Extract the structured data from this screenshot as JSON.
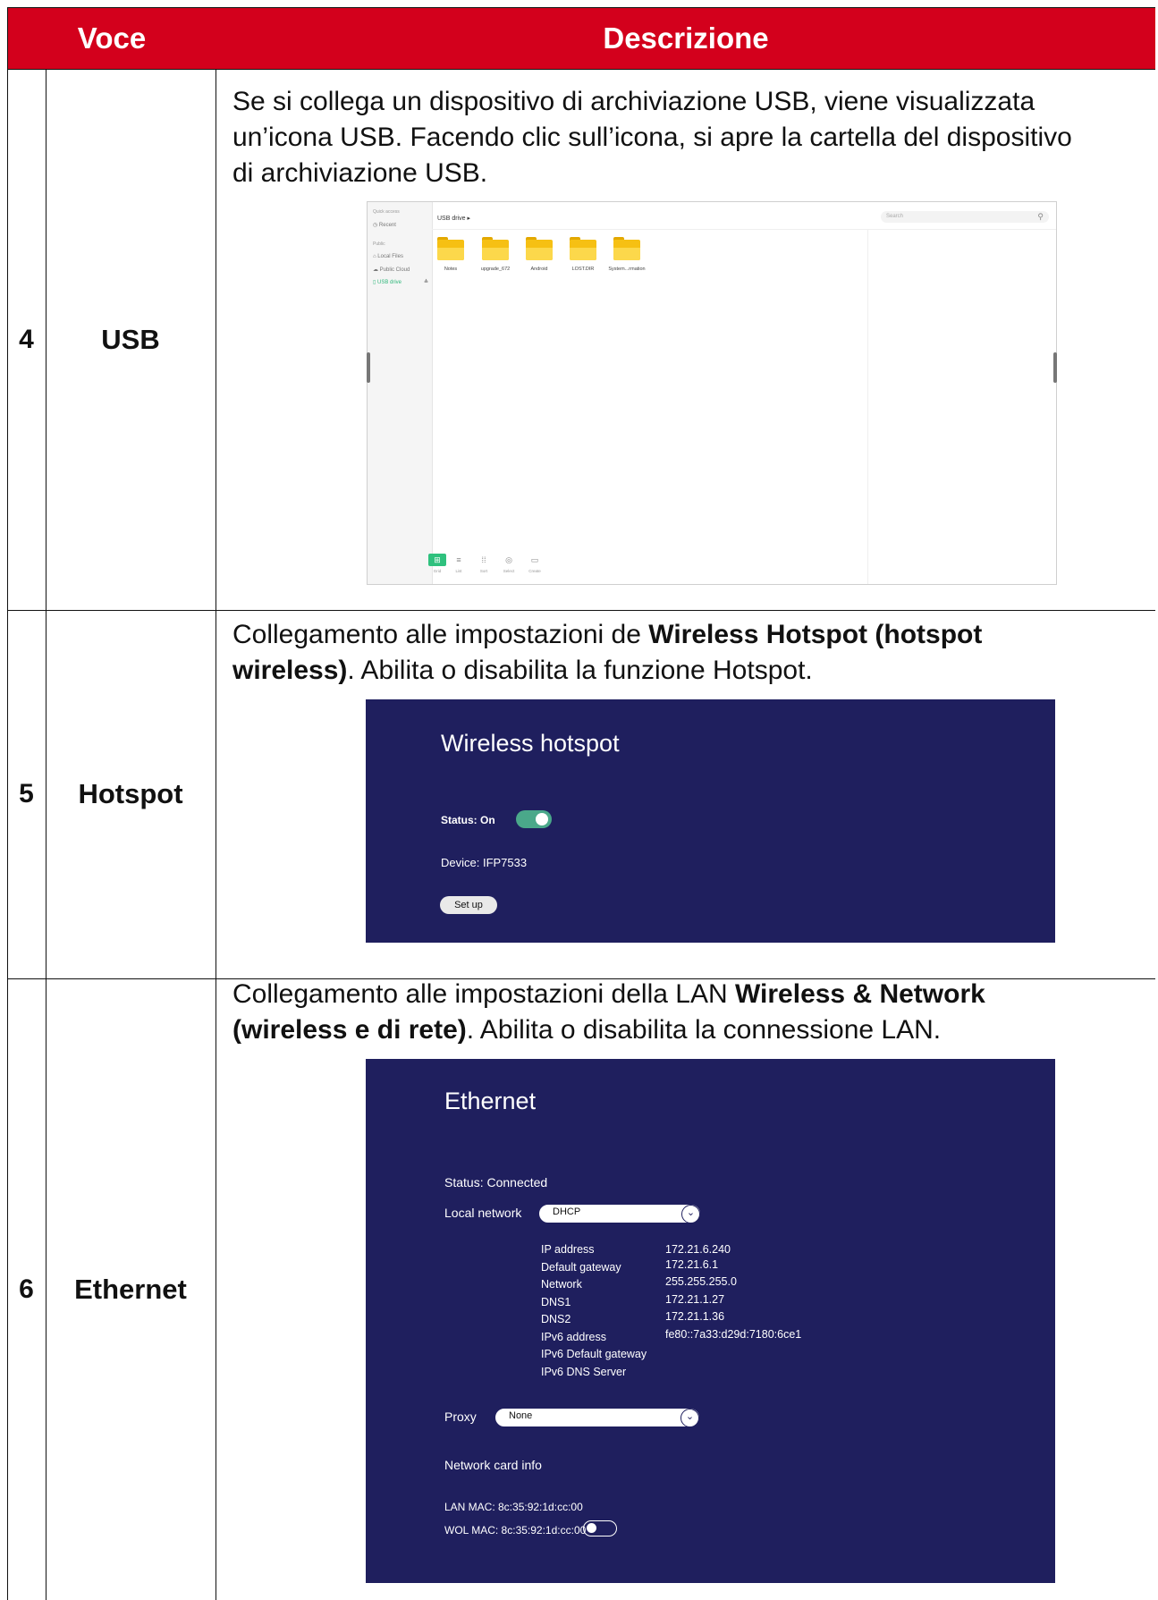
{
  "header": {
    "col_item": "Voce",
    "col_desc": "Descrizione"
  },
  "rows": [
    {
      "number": "4",
      "item": "USB",
      "desc_line1": "Se si collega un dispositivo di archiviazione USB, viene visualizzata",
      "desc_line2": "un’icona USB. Facendo clic sull’icona, si apre la cartella del dispositivo",
      "desc_line3": "di archiviazione USB."
    },
    {
      "number": "5",
      "item": "Hotspot",
      "desc_pre": "Collegamento alle impostazioni de ",
      "desc_bold1": "Wireless Hotspot (hotspot",
      "desc_bold2": "wireless)",
      "desc_post": ". Abilita o disabilita la funzione Hotspot."
    },
    {
      "number": "6",
      "item": "Ethernet",
      "desc_pre": "Collegamento alle impostazioni della LAN ",
      "desc_bold1": "Wireless & Network",
      "desc_bold2": "(wireless e di rete)",
      "desc_post": ". Abilita o disabilita la connessione LAN."
    }
  ],
  "usb_screen": {
    "sidebar": {
      "quick_access": "Quick access",
      "recent": "Recent",
      "public": "Public",
      "local_files": "Local Files",
      "public_cloud": "Public Cloud",
      "usb_drive": "USB drive",
      "eject": "≜"
    },
    "breadcrumb": "USB drive ▸",
    "search_placeholder": "Search",
    "folders": [
      "Notes",
      "upgrade_672",
      "Android",
      "LOST.DIR",
      "System...rmation"
    ],
    "toolbar": [
      "Grid",
      "List",
      "Sort",
      "Select",
      "Create"
    ],
    "accent_color": "#2fc17e"
  },
  "hotspot_screen": {
    "title": "Wireless hotspot",
    "status_label": "Status: On",
    "toggle_on": true,
    "device_label": "Device:  IFP7533",
    "setup_button": "Set up",
    "toggle_color": "#4aa88a",
    "bg_color": "#1f1f5e"
  },
  "ethernet_screen": {
    "title": "Ethernet",
    "status": "Status: Connected",
    "local_network_label": "Local network",
    "local_network_value": "DHCP",
    "fields": [
      {
        "label": "IP address",
        "value": "172.21.6.240"
      },
      {
        "label": "Default gateway",
        "value": "172.21.6.1"
      },
      {
        "label": "Network",
        "value": "255.255.255.0"
      },
      {
        "label": "DNS1",
        "value": "172.21.1.27"
      },
      {
        "label": "DNS2",
        "value": "172.21.1.36"
      },
      {
        "label": "IPv6 address",
        "value": "fe80::7a33:d29d:7180:6ce1"
      },
      {
        "label": "IPv6 Default gateway",
        "value": ""
      },
      {
        "label": "IPv6 DNS Server",
        "value": ""
      }
    ],
    "proxy_label": "Proxy",
    "proxy_value": "None",
    "network_card_info": "Network card info",
    "lan_mac": "LAN MAC: 8c:35:92:1d:cc:00",
    "wol_mac": "WOL MAC: 8c:35:92:1d:cc:00",
    "wol_toggle_on": false
  }
}
